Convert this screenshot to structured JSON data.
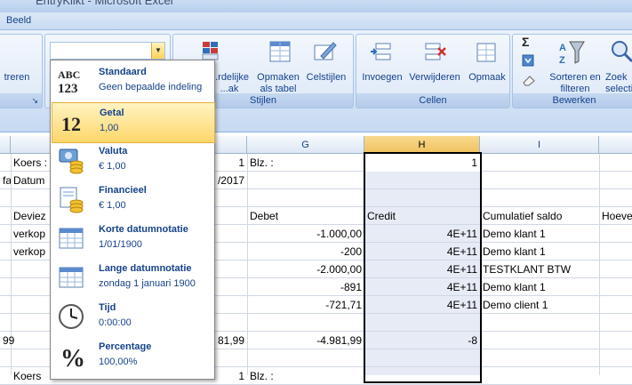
{
  "window": {
    "title": "EntryKlikt - Microsoft Excel"
  },
  "menu": {
    "tab_label": "Beeld"
  },
  "ribbon": {
    "left_partial": "treren",
    "groups": {
      "styles": {
        "label": "Stijlen",
        "cond_format": "...rdelijke",
        "cond_format_line2": "...ak",
        "format_as_table_line1": "Opmaken",
        "format_as_table_line2": "als tabel",
        "cell_styles": "Celstijlen"
      },
      "cells": {
        "label": "Cellen",
        "insert": "Invoegen",
        "delete": "Verwijderen",
        "format": "Opmaak"
      },
      "editing": {
        "label": "Bewerken",
        "sort_filter_line1": "Sorteren en",
        "sort_filter_line2": "filteren",
        "find_line1": "Zoek",
        "find_line2": "selecti",
        "sigma": "Σ"
      }
    }
  },
  "number_format_dropdown": {
    "items": [
      {
        "title": "Standaard",
        "sub": "Geen bepaalde indeling",
        "icon": "abc-123-icon"
      },
      {
        "title": "Getal",
        "sub": "1,00",
        "icon": "number-12-icon",
        "selected": true
      },
      {
        "title": "Valuta",
        "sub": "€ 1,00",
        "icon": "currency-icon"
      },
      {
        "title": "Financieel",
        "sub": "€ 1,00",
        "icon": "accounting-icon"
      },
      {
        "title": "Korte datumnotatie",
        "sub": "1/01/1900",
        "icon": "calendar-short-icon"
      },
      {
        "title": "Lange datumnotatie",
        "sub": "zondag 1 januari 1900",
        "icon": "calendar-long-icon"
      },
      {
        "title": "Tijd",
        "sub": "0:00:00",
        "icon": "clock-icon"
      },
      {
        "title": "Percentage",
        "sub": "100,00%",
        "icon": "percent-icon"
      }
    ]
  },
  "grid": {
    "columns": [
      "G",
      "H",
      "I"
    ],
    "cells": {
      "r1_a": "Koers :",
      "r1_e": "1",
      "r1_f": "Blz. :",
      "r1_h": "1",
      "r2_a": "fa",
      "r2_b": "Datum",
      "r2_e": "/2017",
      "r4_b": "Deviez",
      "r4_g": "Debet",
      "r4_h": "Credit",
      "r4_i": "Cumulatief saldo",
      "r4_j": "Hoeve",
      "r5_b": "verkop",
      "r5_g": "-1.000,00",
      "r5_h": "4E+11",
      "r5_i": "Demo klant 1",
      "r6_b": "verkop",
      "r6_g": "-200",
      "r6_h": "4E+11",
      "r6_i": "Demo klant 1",
      "r7_g": "-2.000,00",
      "r7_h": "4E+11",
      "r7_i": "TESTKLANT BTW",
      "r8_g": "-891",
      "r8_h": "4E+11",
      "r8_i": "Demo klant 1",
      "r9_g": "-721,71",
      "r9_h": "4E+11",
      "r9_i": "Demo client 1",
      "r11_a": "99",
      "r11_e": "81,99",
      "r11_g": "-4.981,99",
      "r11_h": "-8",
      "r13_a": "Koers",
      "r13_e": "1",
      "r13_f": "Blz. :"
    }
  }
}
